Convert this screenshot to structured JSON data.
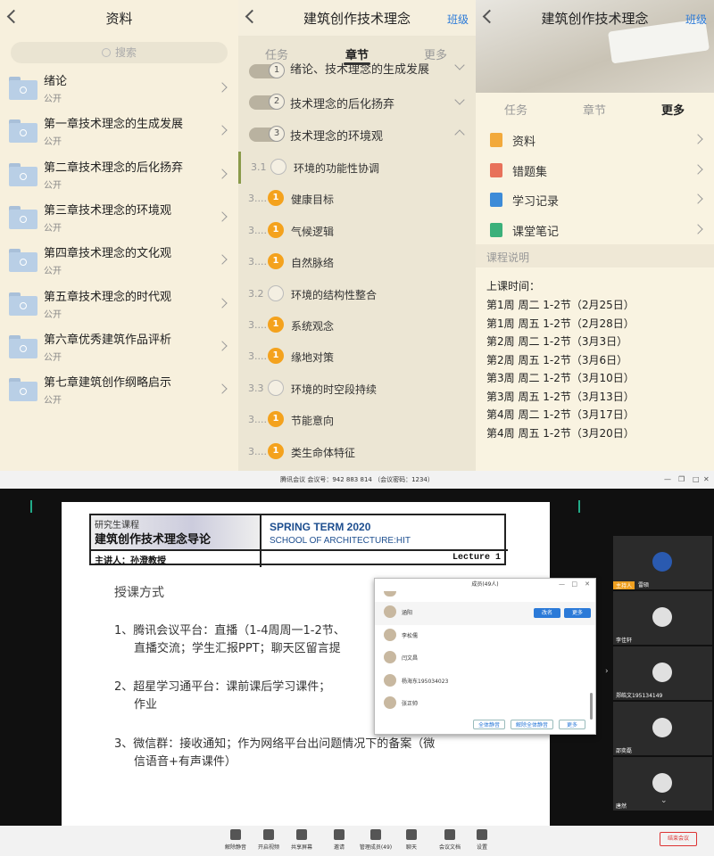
{
  "panel1": {
    "title": "资料",
    "search_placeholder": "搜索",
    "items": [
      {
        "title": "绪论",
        "sub": "公开"
      },
      {
        "title": "第一章技术理念的生成发展",
        "sub": "公开"
      },
      {
        "title": "第二章技术理念的后化扬弃",
        "sub": "公开"
      },
      {
        "title": "第三章技术理念的环境观",
        "sub": "公开"
      },
      {
        "title": "第四章技术理念的文化观",
        "sub": "公开"
      },
      {
        "title": "第五章技术理念的时代观",
        "sub": "公开"
      },
      {
        "title": "第六章优秀建筑作品评析",
        "sub": "公开"
      },
      {
        "title": "第七章建筑创作纲略启示",
        "sub": "公开"
      }
    ]
  },
  "panel2": {
    "title": "建筑创作技术理念",
    "right": "班级",
    "tabs": [
      "任务",
      "章节",
      "更多"
    ],
    "chapters": [
      {
        "num": "1",
        "title": "绪论、技术理念的生成发展"
      },
      {
        "num": "2",
        "title": "技术理念的后化扬弃"
      },
      {
        "num": "3",
        "title": "技术理念的环境观"
      }
    ],
    "sections": [
      {
        "num": "3.1",
        "badge": "",
        "title": "环境的功能性协调"
      },
      {
        "num": "3....",
        "badge": "1",
        "title": "健康目标"
      },
      {
        "num": "3....",
        "badge": "1",
        "title": "气候逻辑"
      },
      {
        "num": "3....",
        "badge": "1",
        "title": "自然脉络"
      },
      {
        "num": "3.2",
        "badge": "",
        "title": "环境的结构性整合"
      },
      {
        "num": "3....",
        "badge": "1",
        "title": "系统观念"
      },
      {
        "num": "3....",
        "badge": "1",
        "title": "缘地对策"
      },
      {
        "num": "3.3",
        "badge": "",
        "title": "环境的时空段持续"
      },
      {
        "num": "3....",
        "badge": "1",
        "title": "节能意向"
      },
      {
        "num": "3....",
        "badge": "1",
        "title": "类生命体特征"
      }
    ]
  },
  "panel3": {
    "title": "建筑创作技术理念",
    "right": "班级",
    "tabs": [
      "任务",
      "章节",
      "更多"
    ],
    "items": [
      {
        "title": "资料",
        "color": "#f2a93b"
      },
      {
        "title": "错题集",
        "color": "#e8715a"
      },
      {
        "title": "学习记录",
        "color": "#3d8bd8"
      },
      {
        "title": "课堂笔记",
        "color": "#3bb07a"
      }
    ],
    "section_label": "课程说明",
    "schedule_title": "上课时间：",
    "schedule": [
      "第1周 周二 1-2节（2月25日）",
      "第1周 周五 1-2节（2月28日）",
      "第2周 周二 1-2节（3月3日）",
      "第2周 周五 1-2节（3月6日）",
      "第3周 周二 1-2节（3月10日）",
      "第3周 周五 1-2节（3月13日）",
      "第4周 周二 1-2节（3月17日）",
      "第4周 周五 1-2节（3月20日）"
    ]
  },
  "meeting": {
    "window_title": "腾讯会议 会议号：942 883 814 （会议密码：1234）",
    "slide": {
      "course_type": "研究生课程",
      "course_name": "建筑创作技术理念导论",
      "term": "SPRING TERM 2020",
      "school": "SCHOOL OF ARCHITECTURE:HIT",
      "lecturer": "主讲人：孙澄教授",
      "lecture": "Lecture 1",
      "heading": "授课方式",
      "point1_a": "1、腾讯会议平台：直播（1-4周周一1-2节、",
      "point1_b": "直播交流；学生汇报PPT；聊天区留言提",
      "point2_a": "2、超星学习通平台：课前课后学习课件；",
      "point2_b": "作业",
      "point3_a": "3、微信群：接收通知；作为网络平台出问题情况下的备案（微",
      "point3_b": "信语音+有声课件）"
    },
    "members": {
      "title": "成员(49人)",
      "list": [
        "涵阳",
        "李松儒",
        "闫文昌",
        "杨海东195034023",
        "张正帅"
      ],
      "rename": "改名",
      "more": "更多",
      "mute_all": "全体静音",
      "unmute_all": "解除全体静音",
      "more2": "更多"
    },
    "videos": [
      {
        "name": "雷硕",
        "host": "主持人"
      },
      {
        "name": "李佳轩",
        "host": ""
      },
      {
        "name": "郑皓文195134149",
        "host": ""
      },
      {
        "name": "邵奕磊",
        "host": ""
      },
      {
        "name": "唐然",
        "host": ""
      }
    ],
    "toolbar": [
      "解除静音",
      "开启视频",
      "共享屏幕",
      "邀请",
      "管理成员(49)",
      "聊天",
      "会议文档",
      "设置"
    ],
    "end_button": "结束会议"
  }
}
